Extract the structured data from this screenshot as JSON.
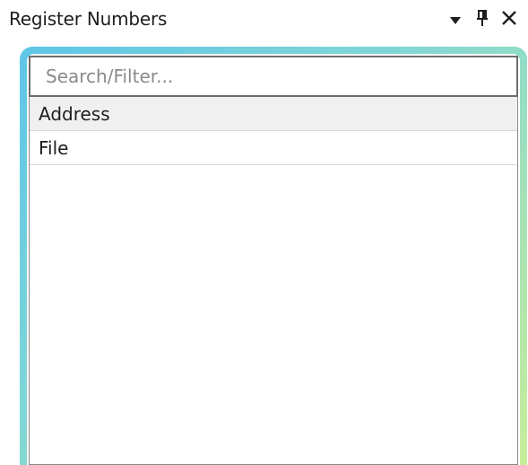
{
  "panel": {
    "title": "Register Numbers",
    "buttons": {
      "dropdown_icon": "chevron-down-icon",
      "pin_icon": "pin-icon",
      "close_icon": "close-icon"
    }
  },
  "search": {
    "placeholder": "Search/Filter...",
    "value": ""
  },
  "list": {
    "items": [
      {
        "label": "Address",
        "selected": true
      },
      {
        "label": "File",
        "selected": false
      }
    ]
  },
  "colors": {
    "frame_gradient_start": "#5ec6e8",
    "frame_gradient_end": "#c7ee9a",
    "selected_row": "#f0f0f0",
    "text": "#1e1e1e",
    "placeholder": "#8a8a8a"
  }
}
